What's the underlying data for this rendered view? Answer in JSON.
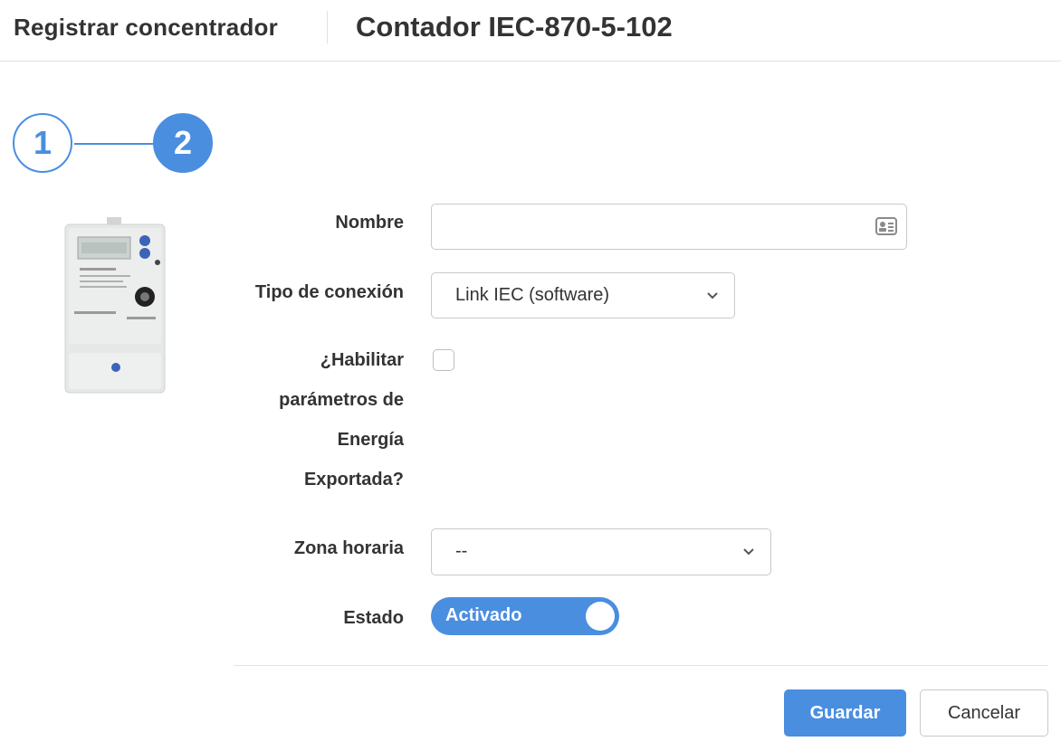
{
  "header": {
    "breadcrumb": "Registrar concentrador",
    "title": "Contador IEC-870-5-102"
  },
  "stepper": {
    "steps": [
      "1",
      "2"
    ],
    "active_step": 2
  },
  "image": {
    "alt": "Contador eléctrico"
  },
  "form": {
    "nombre": {
      "label": "Nombre",
      "value": "",
      "icon": "contact-card-icon"
    },
    "tipo_conexion": {
      "label": "Tipo de conexión",
      "value": "Link IEC (software)"
    },
    "habilitar_energia": {
      "label_lines": [
        "¿Habilitar",
        "parámetros de",
        "Energía",
        "Exportada?"
      ],
      "checked": false
    },
    "zona_horaria": {
      "label": "Zona horaria",
      "value": "--"
    },
    "estado": {
      "label": "Estado",
      "value": "Activado",
      "on": true
    }
  },
  "buttons": {
    "save": "Guardar",
    "cancel": "Cancelar"
  },
  "colors": {
    "accent": "#4a8ee0",
    "text": "#333333",
    "border": "#c9c9c9"
  }
}
